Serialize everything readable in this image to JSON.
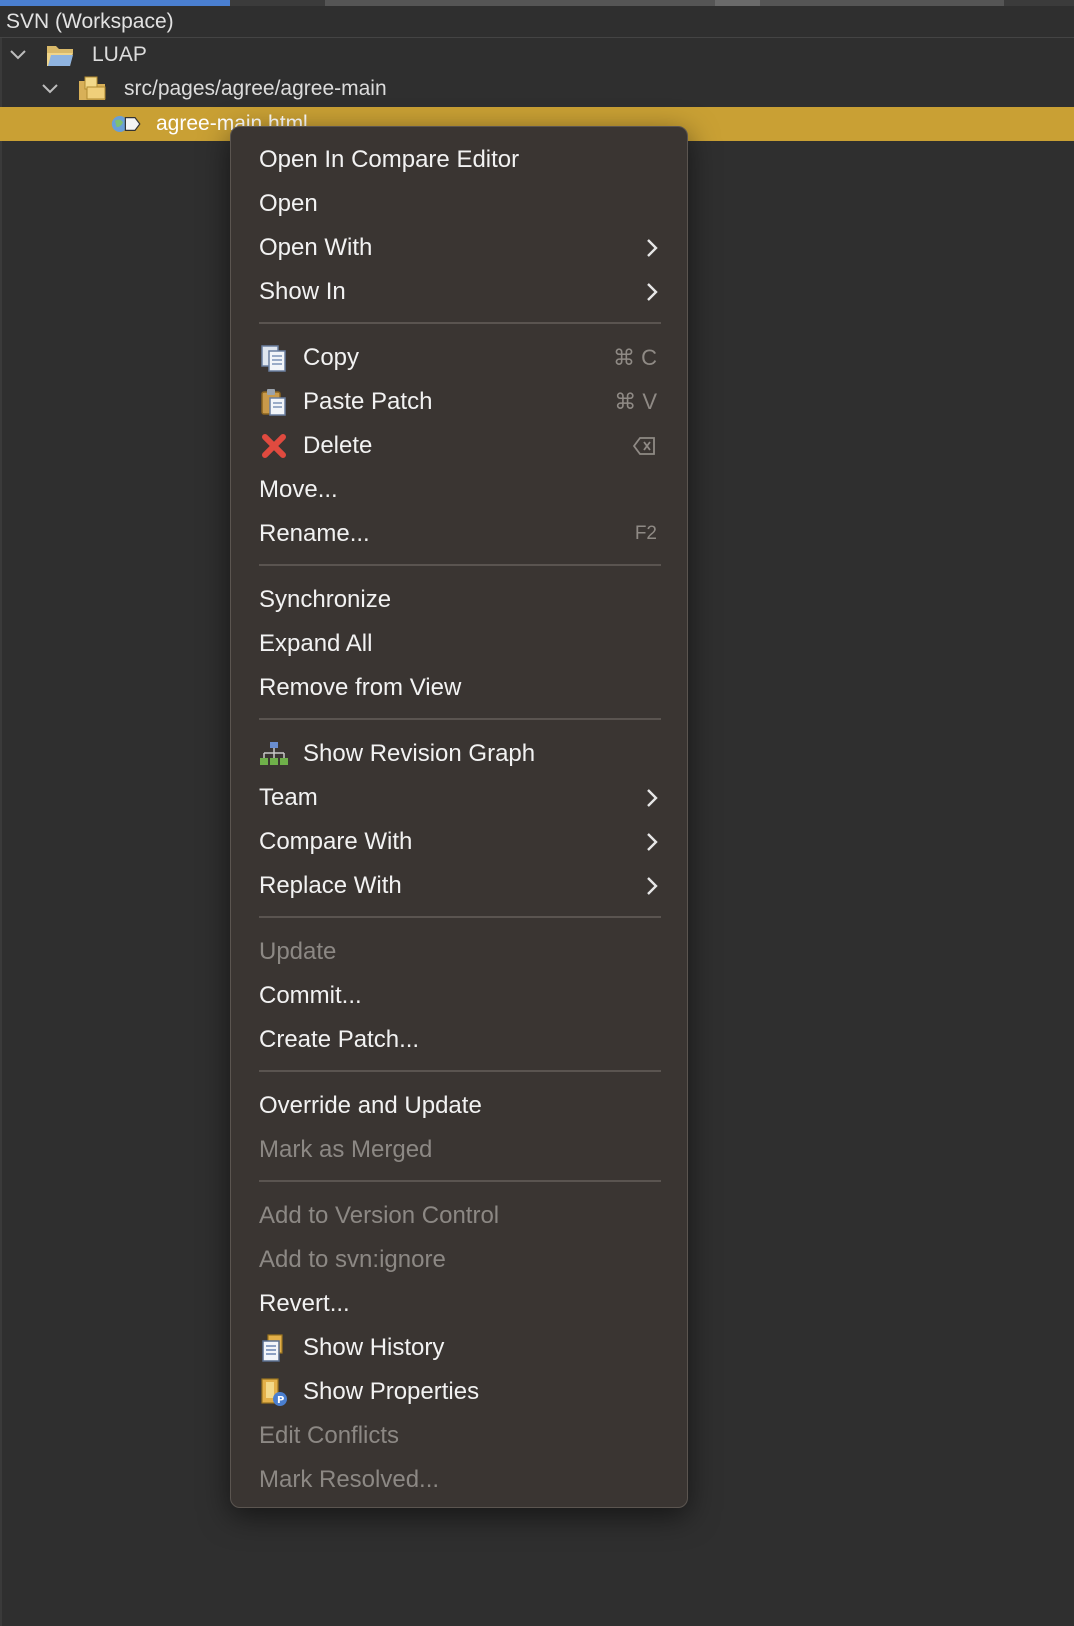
{
  "view": {
    "title": "SVN (Workspace)"
  },
  "tree": {
    "project": "LUAP",
    "folder": "src/pages/agree/agree-main",
    "file": "agree-main.html"
  },
  "menu": {
    "open_compare": "Open In Compare Editor",
    "open": "Open",
    "open_with": "Open With",
    "show_in": "Show In",
    "copy": "Copy",
    "copy_shortcut": "⌘ C",
    "paste_patch": "Paste Patch",
    "paste_shortcut": "⌘ V",
    "delete": "Delete",
    "move": "Move...",
    "rename": "Rename...",
    "rename_shortcut": "F2",
    "synchronize": "Synchronize",
    "expand_all": "Expand All",
    "remove_from_view": "Remove from View",
    "show_revision_graph": "Show Revision Graph",
    "team": "Team",
    "compare_with": "Compare With",
    "replace_with": "Replace With",
    "update": "Update",
    "commit": "Commit...",
    "create_patch": "Create Patch...",
    "override_update": "Override and Update",
    "mark_merged": "Mark as Merged",
    "add_version_control": "Add to Version Control",
    "add_svn_ignore": "Add to svn:ignore",
    "revert": "Revert...",
    "show_history": "Show History",
    "show_properties": "Show Properties",
    "edit_conflicts": "Edit Conflicts",
    "mark_resolved": "Mark Resolved..."
  },
  "colors": {
    "selection": "#c9a034",
    "menu_bg": "#3a3532",
    "disabled_text": "#8c8884"
  }
}
